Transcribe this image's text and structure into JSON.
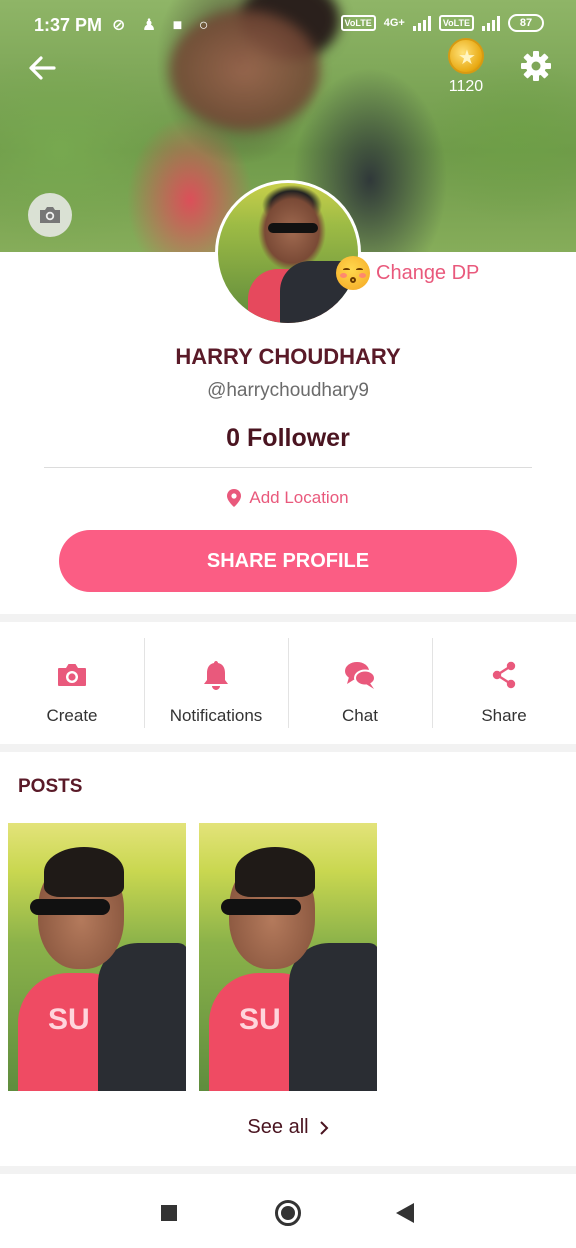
{
  "status_bar": {
    "time": "1:37 PM",
    "network_left": "VoLTE",
    "network_type": "4G+",
    "network_right": "VoLTE",
    "battery": "87"
  },
  "header": {
    "coins": "1120"
  },
  "profile": {
    "change_dp_label": "Change DP",
    "name": "HARRY CHOUDHARY",
    "handle": "@harrychoudhary9",
    "followers": "0 Follower",
    "location_label": "Add Location",
    "share_button": "SHARE PROFILE"
  },
  "actions": [
    {
      "label": "Create",
      "icon": "camera-icon"
    },
    {
      "label": "Notifications",
      "icon": "bell-icon"
    },
    {
      "label": "Chat",
      "icon": "chat-icon"
    },
    {
      "label": "Share",
      "icon": "share-icon"
    }
  ],
  "posts": {
    "title": "POSTS",
    "see_all": "See all"
  },
  "colors": {
    "accent": "#fb5d84",
    "accent_text": "#e9597c",
    "title": "#5a1a28"
  }
}
